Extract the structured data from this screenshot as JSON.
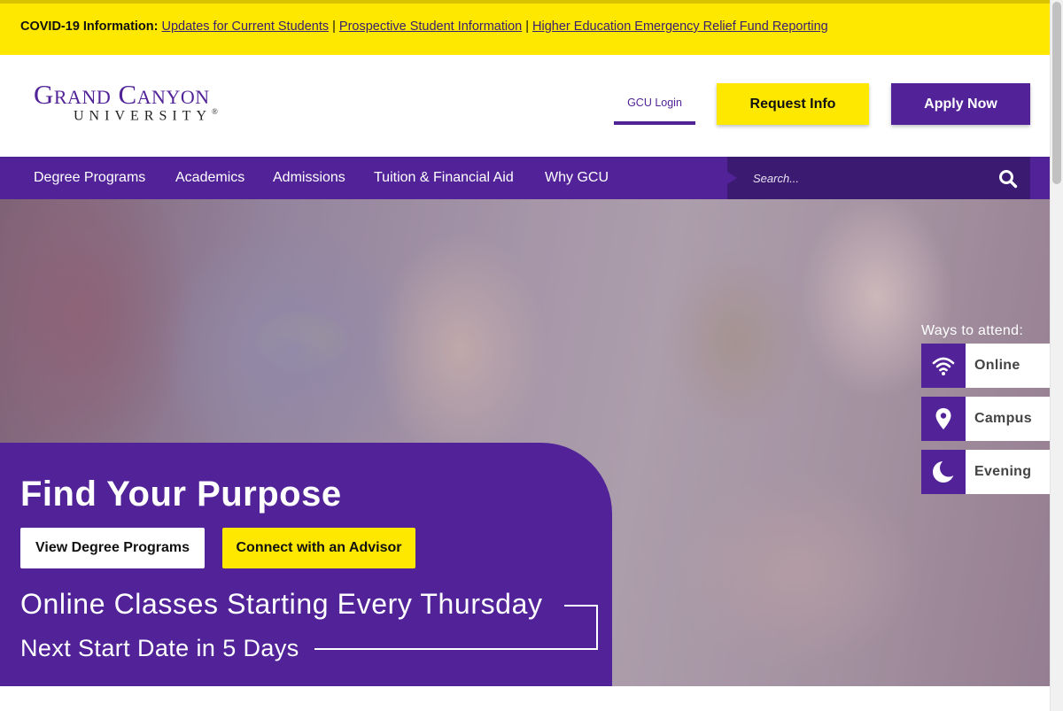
{
  "covid": {
    "label": "COVID-19 Information:",
    "links": [
      "Updates for Current Students",
      "Prospective Student Information",
      "Higher Education Emergency Relief Fund Reporting"
    ],
    "separator": "|"
  },
  "header": {
    "logo_line1": "Grand Canyon",
    "logo_line2": "UNIVERSITY",
    "logo_mark": "®",
    "login": "GCU Login",
    "request": "Request Info",
    "apply": "Apply Now"
  },
  "nav": {
    "items": [
      "Degree Programs",
      "Academics",
      "Admissions",
      "Tuition & Financial Aid",
      "Why GCU"
    ],
    "search_placeholder": "Search..."
  },
  "hero": {
    "title": "Find Your Purpose",
    "view_button": "View Degree Programs",
    "connect_button": "Connect with an Advisor",
    "online_text": "Online Classes Starting Every Thursday",
    "next_text": "Next Start Date in 5 Days"
  },
  "ways": {
    "title": "Ways to attend:",
    "options": [
      {
        "label": "Online",
        "icon": "wifi-icon"
      },
      {
        "label": "Campus",
        "icon": "location-pin-icon"
      },
      {
        "label": "Evening",
        "icon": "moon-icon"
      }
    ]
  },
  "colors": {
    "brand_purple": "#522398",
    "accent_yellow": "#ffe800"
  }
}
